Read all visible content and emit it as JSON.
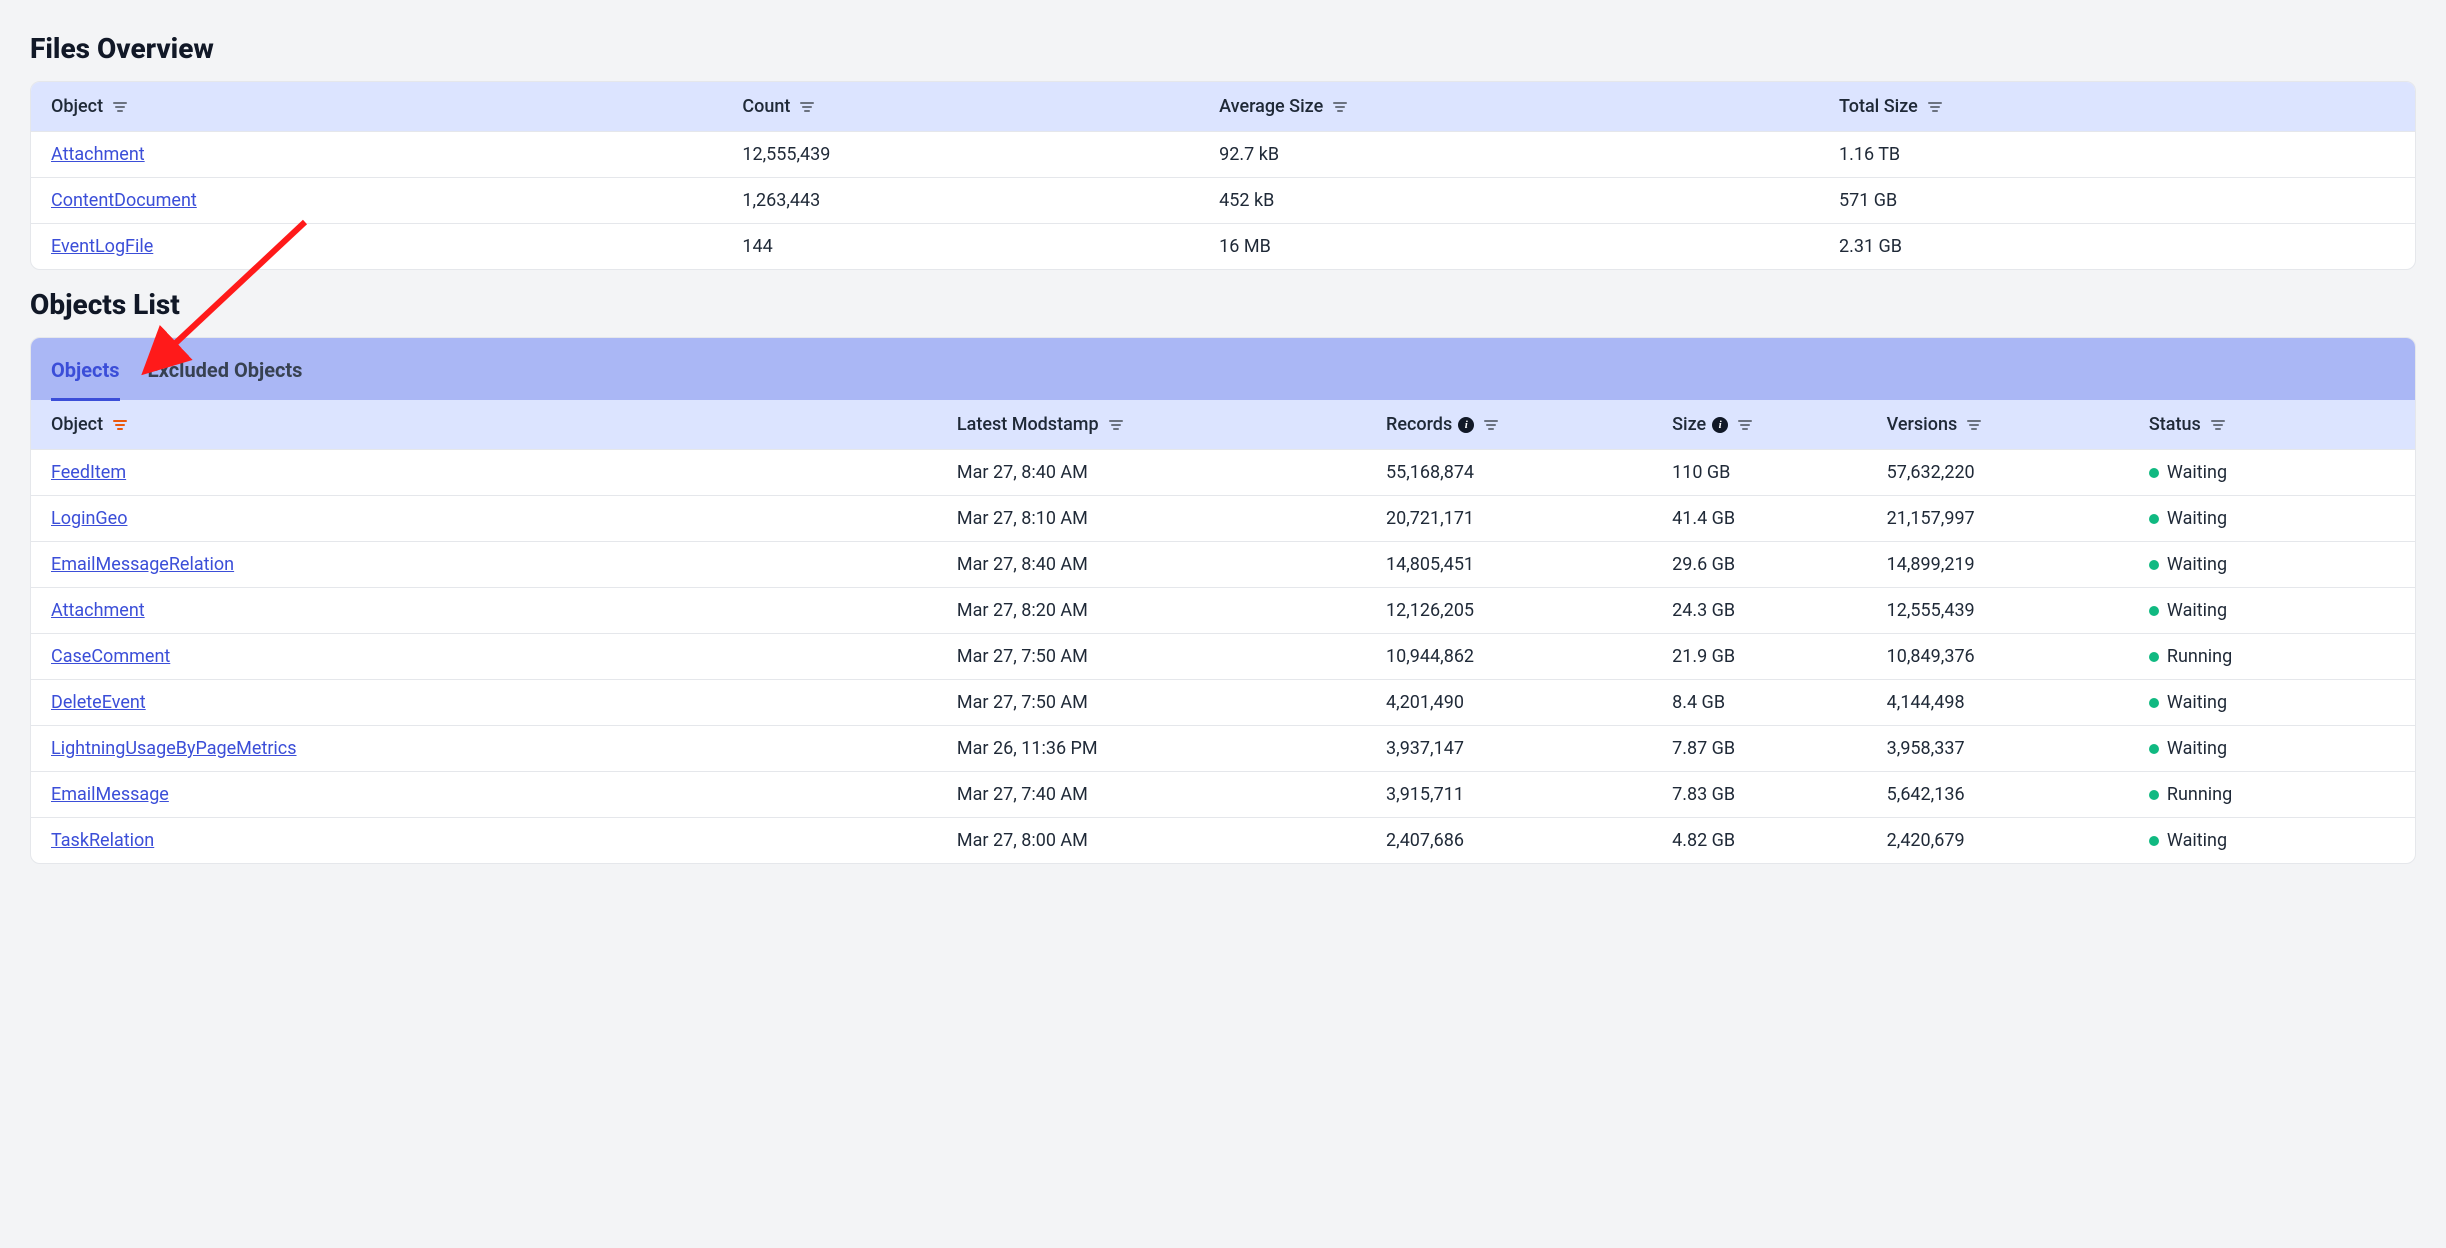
{
  "filesOverview": {
    "title": "Files Overview",
    "columns": {
      "object": "Object",
      "count": "Count",
      "avgSize": "Average Size",
      "totalSize": "Total Size"
    },
    "rows": [
      {
        "object": "Attachment",
        "count": "12,555,439",
        "avgSize": "92.7 kB",
        "totalSize": "1.16 TB"
      },
      {
        "object": "ContentDocument",
        "count": "1,263,443",
        "avgSize": "452 kB",
        "totalSize": "571 GB"
      },
      {
        "object": "EventLogFile",
        "count": "144",
        "avgSize": "16 MB",
        "totalSize": "2.31 GB"
      }
    ]
  },
  "objectsList": {
    "title": "Objects List",
    "tabs": {
      "objects": "Objects",
      "excluded": "Excluded Objects"
    },
    "columns": {
      "object": "Object",
      "modstamp": "Latest Modstamp",
      "records": "Records",
      "size": "Size",
      "versions": "Versions",
      "status": "Status"
    },
    "rows": [
      {
        "object": "FeedItem",
        "modstamp": "Mar 27, 8:40 AM",
        "records": "55,168,874",
        "size": "110 GB",
        "versions": "57,632,220",
        "status": "Waiting"
      },
      {
        "object": "LoginGeo",
        "modstamp": "Mar 27, 8:10 AM",
        "records": "20,721,171",
        "size": "41.4 GB",
        "versions": "21,157,997",
        "status": "Waiting"
      },
      {
        "object": "EmailMessageRelation",
        "modstamp": "Mar 27, 8:40 AM",
        "records": "14,805,451",
        "size": "29.6 GB",
        "versions": "14,899,219",
        "status": "Waiting"
      },
      {
        "object": "Attachment",
        "modstamp": "Mar 27, 8:20 AM",
        "records": "12,126,205",
        "size": "24.3 GB",
        "versions": "12,555,439",
        "status": "Waiting"
      },
      {
        "object": "CaseComment",
        "modstamp": "Mar 27, 7:50 AM",
        "records": "10,944,862",
        "size": "21.9 GB",
        "versions": "10,849,376",
        "status": "Running"
      },
      {
        "object": "DeleteEvent",
        "modstamp": "Mar 27, 7:50 AM",
        "records": "4,201,490",
        "size": "8.4 GB",
        "versions": "4,144,498",
        "status": "Waiting"
      },
      {
        "object": "LightningUsageByPageMetrics",
        "modstamp": "Mar 26, 11:36 PM",
        "records": "3,937,147",
        "size": "7.87 GB",
        "versions": "3,958,337",
        "status": "Waiting"
      },
      {
        "object": "EmailMessage",
        "modstamp": "Mar 27, 7:40 AM",
        "records": "3,915,711",
        "size": "7.83 GB",
        "versions": "5,642,136",
        "status": "Running"
      },
      {
        "object": "TaskRelation",
        "modstamp": "Mar 27, 8:00 AM",
        "records": "2,407,686",
        "size": "4.82 GB",
        "versions": "2,420,679",
        "status": "Waiting"
      }
    ]
  }
}
